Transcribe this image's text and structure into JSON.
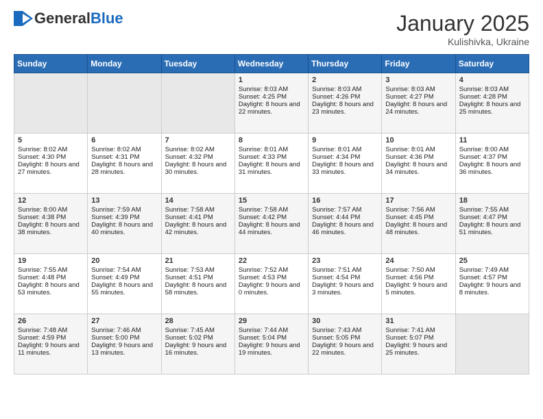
{
  "header": {
    "logo": {
      "general": "General",
      "blue": "Blue"
    },
    "title": "January 2025",
    "location": "Kulishivka, Ukraine"
  },
  "days_of_week": [
    "Sunday",
    "Monday",
    "Tuesday",
    "Wednesday",
    "Thursday",
    "Friday",
    "Saturday"
  ],
  "weeks": [
    [
      {
        "day": "",
        "content": ""
      },
      {
        "day": "",
        "content": ""
      },
      {
        "day": "",
        "content": ""
      },
      {
        "day": "1",
        "content": "Sunrise: 8:03 AM\nSunset: 4:25 PM\nDaylight: 8 hours and 22 minutes."
      },
      {
        "day": "2",
        "content": "Sunrise: 8:03 AM\nSunset: 4:26 PM\nDaylight: 8 hours and 23 minutes."
      },
      {
        "day": "3",
        "content": "Sunrise: 8:03 AM\nSunset: 4:27 PM\nDaylight: 8 hours and 24 minutes."
      },
      {
        "day": "4",
        "content": "Sunrise: 8:03 AM\nSunset: 4:28 PM\nDaylight: 8 hours and 25 minutes."
      }
    ],
    [
      {
        "day": "5",
        "content": "Sunrise: 8:02 AM\nSunset: 4:30 PM\nDaylight: 8 hours and 27 minutes."
      },
      {
        "day": "6",
        "content": "Sunrise: 8:02 AM\nSunset: 4:31 PM\nDaylight: 8 hours and 28 minutes."
      },
      {
        "day": "7",
        "content": "Sunrise: 8:02 AM\nSunset: 4:32 PM\nDaylight: 8 hours and 30 minutes."
      },
      {
        "day": "8",
        "content": "Sunrise: 8:01 AM\nSunset: 4:33 PM\nDaylight: 8 hours and 31 minutes."
      },
      {
        "day": "9",
        "content": "Sunrise: 8:01 AM\nSunset: 4:34 PM\nDaylight: 8 hours and 33 minutes."
      },
      {
        "day": "10",
        "content": "Sunrise: 8:01 AM\nSunset: 4:36 PM\nDaylight: 8 hours and 34 minutes."
      },
      {
        "day": "11",
        "content": "Sunrise: 8:00 AM\nSunset: 4:37 PM\nDaylight: 8 hours and 36 minutes."
      }
    ],
    [
      {
        "day": "12",
        "content": "Sunrise: 8:00 AM\nSunset: 4:38 PM\nDaylight: 8 hours and 38 minutes."
      },
      {
        "day": "13",
        "content": "Sunrise: 7:59 AM\nSunset: 4:39 PM\nDaylight: 8 hours and 40 minutes."
      },
      {
        "day": "14",
        "content": "Sunrise: 7:58 AM\nSunset: 4:41 PM\nDaylight: 8 hours and 42 minutes."
      },
      {
        "day": "15",
        "content": "Sunrise: 7:58 AM\nSunset: 4:42 PM\nDaylight: 8 hours and 44 minutes."
      },
      {
        "day": "16",
        "content": "Sunrise: 7:57 AM\nSunset: 4:44 PM\nDaylight: 8 hours and 46 minutes."
      },
      {
        "day": "17",
        "content": "Sunrise: 7:56 AM\nSunset: 4:45 PM\nDaylight: 8 hours and 48 minutes."
      },
      {
        "day": "18",
        "content": "Sunrise: 7:55 AM\nSunset: 4:47 PM\nDaylight: 8 hours and 51 minutes."
      }
    ],
    [
      {
        "day": "19",
        "content": "Sunrise: 7:55 AM\nSunset: 4:48 PM\nDaylight: 8 hours and 53 minutes."
      },
      {
        "day": "20",
        "content": "Sunrise: 7:54 AM\nSunset: 4:49 PM\nDaylight: 8 hours and 55 minutes."
      },
      {
        "day": "21",
        "content": "Sunrise: 7:53 AM\nSunset: 4:51 PM\nDaylight: 8 hours and 58 minutes."
      },
      {
        "day": "22",
        "content": "Sunrise: 7:52 AM\nSunset: 4:53 PM\nDaylight: 9 hours and 0 minutes."
      },
      {
        "day": "23",
        "content": "Sunrise: 7:51 AM\nSunset: 4:54 PM\nDaylight: 9 hours and 3 minutes."
      },
      {
        "day": "24",
        "content": "Sunrise: 7:50 AM\nSunset: 4:56 PM\nDaylight: 9 hours and 5 minutes."
      },
      {
        "day": "25",
        "content": "Sunrise: 7:49 AM\nSunset: 4:57 PM\nDaylight: 9 hours and 8 minutes."
      }
    ],
    [
      {
        "day": "26",
        "content": "Sunrise: 7:48 AM\nSunset: 4:59 PM\nDaylight: 9 hours and 11 minutes."
      },
      {
        "day": "27",
        "content": "Sunrise: 7:46 AM\nSunset: 5:00 PM\nDaylight: 9 hours and 13 minutes."
      },
      {
        "day": "28",
        "content": "Sunrise: 7:45 AM\nSunset: 5:02 PM\nDaylight: 9 hours and 16 minutes."
      },
      {
        "day": "29",
        "content": "Sunrise: 7:44 AM\nSunset: 5:04 PM\nDaylight: 9 hours and 19 minutes."
      },
      {
        "day": "30",
        "content": "Sunrise: 7:43 AM\nSunset: 5:05 PM\nDaylight: 9 hours and 22 minutes."
      },
      {
        "day": "31",
        "content": "Sunrise: 7:41 AM\nSunset: 5:07 PM\nDaylight: 9 hours and 25 minutes."
      },
      {
        "day": "",
        "content": ""
      }
    ]
  ]
}
